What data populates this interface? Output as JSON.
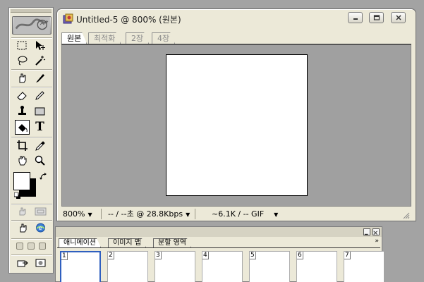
{
  "document": {
    "title": "Untitled-5 @ 800% (원본)",
    "tabs": [
      {
        "label": "원본",
        "active": true
      },
      {
        "label": "최적화",
        "active": false
      },
      {
        "label": "2장",
        "active": false
      },
      {
        "label": "4장",
        "active": false
      }
    ],
    "status": {
      "zoom": "800%",
      "download_time": "-- / --초 @ 28.8Kbps",
      "file_info": "~6.1K / -- GIF"
    },
    "canvas_color": "#ffffff",
    "workspace_color": "#a0a0a0"
  },
  "toolbox": {
    "active_tool": "paint-bucket",
    "type_tool_label": "T",
    "foreground_color": "#ffffff",
    "background_color": "#000000"
  },
  "animation_panel": {
    "tabs": [
      {
        "label": "애니메이션",
        "active": true
      },
      {
        "label": "이미지 맵",
        "active": false
      },
      {
        "label": "분할 영역",
        "active": false
      }
    ],
    "more_glyph": "»",
    "frames": [
      "1",
      "2",
      "3",
      "4",
      "5",
      "6",
      "7"
    ],
    "selected_frame": "1",
    "accent_color": "#2f5fbf"
  }
}
